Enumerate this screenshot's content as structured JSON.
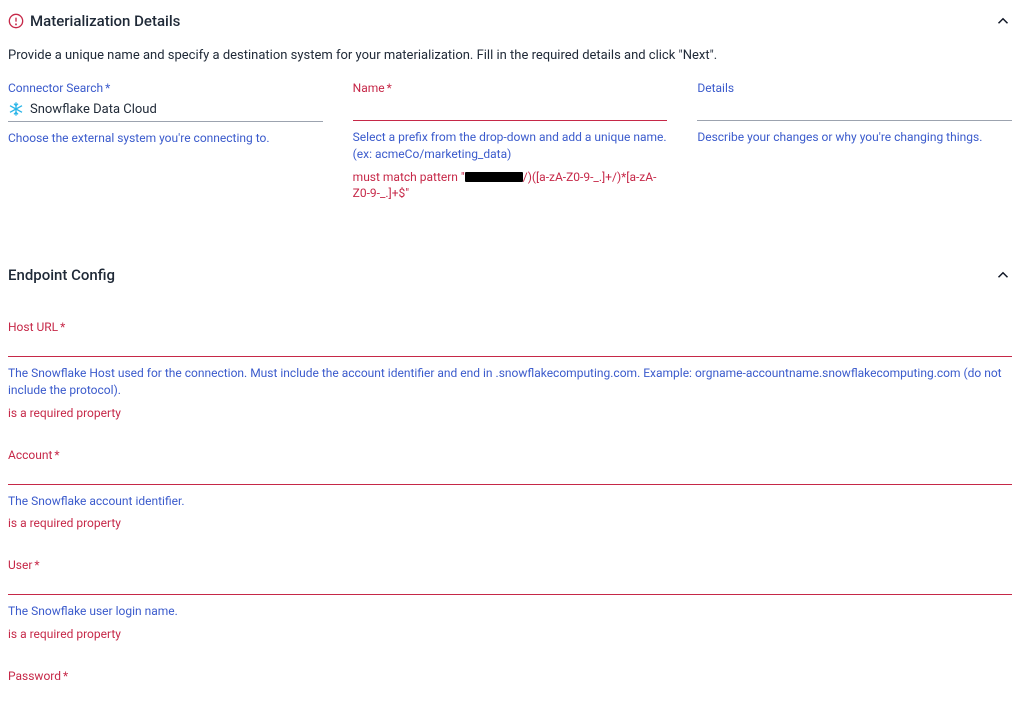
{
  "section1": {
    "title": "Materialization Details",
    "description": "Provide a unique name and specify a destination system for your materialization. Fill in the required details and click \"Next\"."
  },
  "connector": {
    "label": "Connector Search",
    "required": "*",
    "value": "Snowflake Data Cloud",
    "help": "Choose the external system you're connecting to."
  },
  "name": {
    "label": "Name",
    "required": "*",
    "help": "Select a prefix from the drop-down and add a unique name. (ex: acmeCo/marketing_data)",
    "error_prefix": "must match pattern \"",
    "error_suffix": "/)([a-zA-Z0-9-_.]+/)*[a-zA-Z0-9-_.]+$\""
  },
  "details": {
    "label": "Details",
    "help": "Describe your changes or why you're changing things."
  },
  "section2": {
    "title": "Endpoint Config"
  },
  "host": {
    "label": "Host URL",
    "required": "*",
    "help": "The Snowflake Host used for the connection. Must include the account identifier and end in .snowflakecomputing.com. Example: orgname-accountname.snowflakecomputing.com (do not include the protocol).",
    "error": "is a required property"
  },
  "account": {
    "label": "Account",
    "required": "*",
    "help": "The Snowflake account identifier.",
    "error": "is a required property"
  },
  "user": {
    "label": "User",
    "required": "*",
    "help": "The Snowflake user login name.",
    "error": "is a required property"
  },
  "password": {
    "label": "Password",
    "required": "*"
  }
}
